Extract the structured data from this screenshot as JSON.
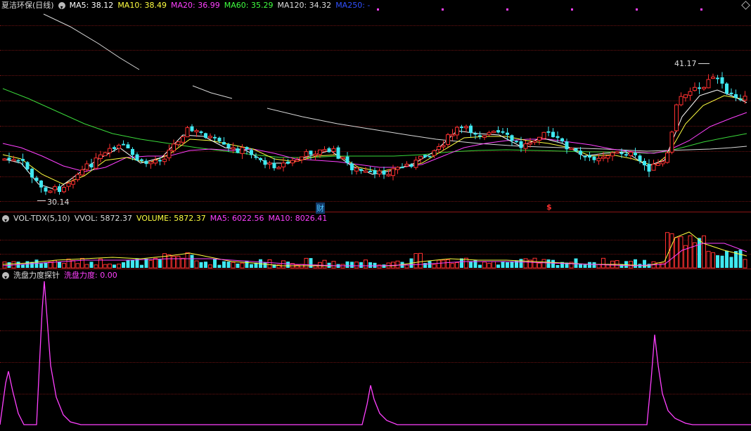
{
  "main_header": {
    "stock_title": "夏洁环保(日线)",
    "ma": [
      {
        "label": "MA5: 38.12",
        "color": "#ffffff"
      },
      {
        "label": "MA10: 38.49",
        "color": "#ffff40"
      },
      {
        "label": "MA20: 36.99",
        "color": "#ff40ff"
      },
      {
        "label": "MA60: 35.29",
        "color": "#40ff40"
      },
      {
        "label": "MA120: 34.32",
        "color": "#dddddd"
      },
      {
        "label": "MA250: -",
        "color": "#3050ff"
      }
    ]
  },
  "price_annotations": {
    "high": "41.17",
    "low": "30.14",
    "cai_marker": "财",
    "dollar_marker": "$"
  },
  "volume_header": {
    "indicator_name": "VOL-TDX(5,10)",
    "items": [
      {
        "label": "VVOL: 5872.37",
        "color": "#dddddd"
      },
      {
        "label": "VOLUME: 5872.37",
        "color": "#ffff40"
      },
      {
        "label": "MA5: 6022.56",
        "color": "#ff40ff"
      },
      {
        "label": "MA10: 8026.41",
        "color": "#ff40ff"
      }
    ]
  },
  "indicator_header": {
    "name": "洗盘力度探针",
    "value_label": "洗盘力度: 0.00",
    "value_color": "#ff40ff"
  },
  "colors": {
    "up": "#ff3030",
    "down": "#40e8f0",
    "grid": "#6a1111",
    "pane_border": "#8a1414"
  }
}
